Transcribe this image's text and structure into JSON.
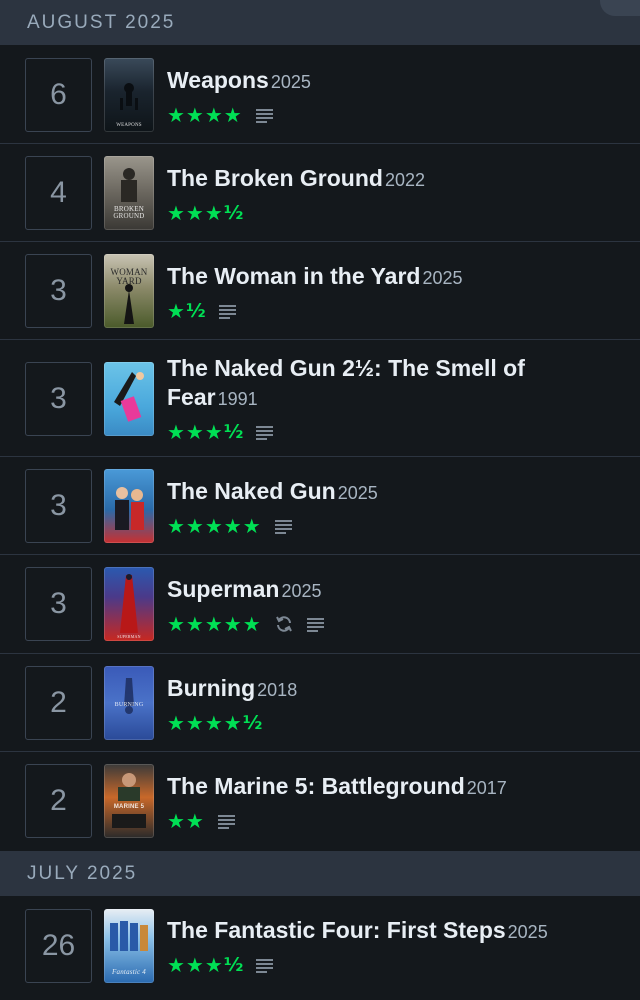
{
  "colors": {
    "background": "#14181c",
    "month_header_bg": "#2c3440",
    "star_green": "#00e054",
    "divider": "#2c3440"
  },
  "sections": [
    {
      "month": "AUGUST 2025",
      "entries": [
        {
          "day": "6",
          "title": "Weapons",
          "year": "2025",
          "stars": "★★★★",
          "half": "",
          "review": true,
          "rewatch": false,
          "poster_text": "WEAPONS"
        },
        {
          "day": "4",
          "title": "The Broken Ground",
          "year": "2022",
          "stars": "★★★",
          "half": "½",
          "review": false,
          "rewatch": false,
          "poster_text": "BROKEN GROUND"
        },
        {
          "day": "3",
          "title": "The Woman in the Yard",
          "year": "2025",
          "stars": "★",
          "half": "½",
          "review": true,
          "rewatch": false,
          "poster_text": "WOMAN YARD"
        },
        {
          "day": "3",
          "title": "The Naked Gun 2½: The Smell of Fear",
          "year": "1991",
          "stars": "★★★",
          "half": "½",
          "review": true,
          "rewatch": false,
          "poster_text": ""
        },
        {
          "day": "3",
          "title": "The Naked Gun",
          "year": "2025",
          "stars": "★★★★★",
          "half": "",
          "review": true,
          "rewatch": false,
          "poster_text": ""
        },
        {
          "day": "3",
          "title": "Superman",
          "year": "2025",
          "stars": "★★★★★",
          "half": "",
          "review": true,
          "rewatch": true,
          "poster_text": "SUPERMAN"
        },
        {
          "day": "2",
          "title": "Burning",
          "year": "2018",
          "stars": "★★★★",
          "half": "½",
          "review": false,
          "rewatch": false,
          "poster_text": "BURNING"
        },
        {
          "day": "2",
          "title": "The Marine 5: Battleground",
          "year": "2017",
          "stars": "★★",
          "half": "",
          "review": true,
          "rewatch": false,
          "poster_text": "MARINE 5"
        }
      ]
    },
    {
      "month": "JULY 2025",
      "entries": [
        {
          "day": "26",
          "title": "The Fantastic Four: First Steps",
          "year": "2025",
          "stars": "★★★",
          "half": "½",
          "review": true,
          "rewatch": false,
          "poster_text": "Fantastic 4"
        }
      ]
    }
  ],
  "icons": {
    "review": "review-lines-icon",
    "rewatch": "rewatch-icon"
  }
}
